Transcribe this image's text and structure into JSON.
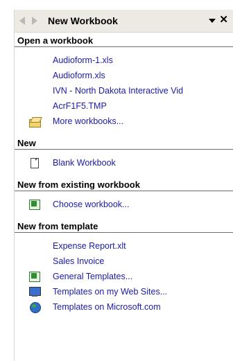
{
  "pane": {
    "title": "New Workbook"
  },
  "sections": {
    "open": {
      "header": "Open a workbook",
      "files": [
        "Audioform-1.xls",
        "Audioform.xls",
        "IVN - North Dakota Interactive Vid",
        "AcrF1F5.TMP"
      ],
      "more": "More workbooks..."
    },
    "new": {
      "header": "New",
      "blank": "Blank Workbook"
    },
    "existing": {
      "header": "New from existing workbook",
      "choose": "Choose workbook..."
    },
    "template": {
      "header": "New from template",
      "items": [
        "Expense Report.xlt",
        "Sales Invoice"
      ],
      "general": "General Templates...",
      "web_sites": "Templates on my Web Sites...",
      "microsoft": "Templates on Microsoft.com"
    }
  },
  "icons": {
    "back": "back-arrow-icon",
    "forward": "forward-arrow-icon",
    "menu": "dropdown-triangle-icon",
    "close": "close-icon",
    "folder": "open-folder-icon",
    "document": "blank-document-icon",
    "workbook": "workbook-icon",
    "general": "excel-templates-icon",
    "web": "web-sites-icon",
    "microsoft": "globe-icon"
  },
  "colors": {
    "link": "#1a1aa6",
    "titlebar": "#eceae3"
  }
}
